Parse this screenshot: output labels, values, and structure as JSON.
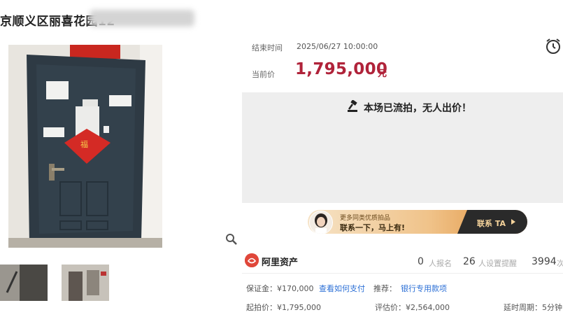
{
  "title": "京顺义区丽喜花园12",
  "info": {
    "end_label": "结束时间",
    "end_time": "2025/06/27 10:00:00",
    "price_label": "当前价",
    "price_value": "1,795,000",
    "price_unit": "元"
  },
  "status": {
    "text": "本场已流拍，无人出价！"
  },
  "banner": {
    "line1": "更多同类优质拍品",
    "line2": "联系一下，马上有!",
    "button": "联系 TA"
  },
  "brand": {
    "name": "阿里资产"
  },
  "stats": {
    "signup_count": "0",
    "signup_label": "人报名",
    "remind_count": "26",
    "remind_label": "人设置提醒",
    "view_count": "3994",
    "view_label": "次"
  },
  "details": {
    "deposit": "保证金：¥170,000",
    "how_pay": "查看如何支付",
    "recommend_label": "推荐：",
    "bank_loan": "银行专用款项",
    "start_price": "起拍价：¥1,795,000",
    "appraisal": "评估价：¥2,564,000",
    "delay": "延时周期：5分钟"
  },
  "icons": [
    "alarm-icon",
    "gavel-icon",
    "search-zoom-icon",
    "brand-logo-icon"
  ],
  "colors": {
    "price": "#b0233a",
    "link": "#2b6fd6",
    "banner_gold": "#f0c38a"
  }
}
